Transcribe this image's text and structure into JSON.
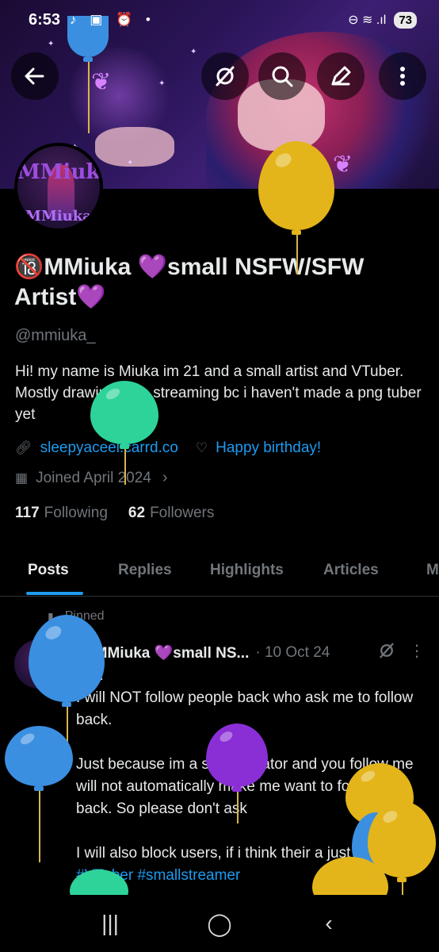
{
  "status_bar": {
    "time": "6:53",
    "left_icons": "♪ ▣ ⏰ •",
    "right_icons": "⊖ ≋ .ıl",
    "battery": "73"
  },
  "header": {
    "back_icon": "back-arrow-icon",
    "grok_icon": "grok-icon",
    "search_icon": "search-icon",
    "edit_icon": "edit-pencil-icon",
    "more_icon": "more-vertical-icon"
  },
  "avatar": {
    "line1": "MMiuka",
    "line2": "MMiuka"
  },
  "profile": {
    "display_name": "🔞MMiuka 💜small NSFW/SFW Artist💜",
    "handle": "@mmiuka_",
    "bio": "Hi! my name is Miuka im 21 and a small artist and VTuber. Mostly drawing then streaming bc i haven't made a png tuber yet",
    "link_text": "sleepyaceei.carrd.co",
    "birthday_text": "Happy birthday!",
    "joined_text": "Joined April 2024",
    "following_count": "117",
    "following_label": "Following",
    "followers_count": "62",
    "followers_label": "Followers"
  },
  "tabs": [
    {
      "label": "Posts",
      "active": true
    },
    {
      "label": "Replies",
      "active": false
    },
    {
      "label": "Highlights",
      "active": false
    },
    {
      "label": "Articles",
      "active": false
    },
    {
      "label": "M",
      "active": false
    }
  ],
  "post": {
    "pinned_label": "Pinned",
    "author": "🔞MMiuka 💜small NS...",
    "date": "· 10 Oct 24",
    "line1": "FYI.",
    "para1": "I will NOT follow people back who ask me to follow back.",
    "para2": "Just because im a small creator and you follow me will not automatically make me want to follow you back. So please don't ask",
    "para3": "I will also block users, if i think their a just fake accs.",
    "hashtags": "#VTuber #smallstreamer"
  },
  "navbar": {
    "recents": "|||",
    "home": "◯",
    "back": "‹"
  },
  "colors": {
    "accent": "#1d9bf0",
    "secondary_text": "#71767b",
    "primary_text": "#e7e9ea",
    "divider": "#2f3336"
  }
}
